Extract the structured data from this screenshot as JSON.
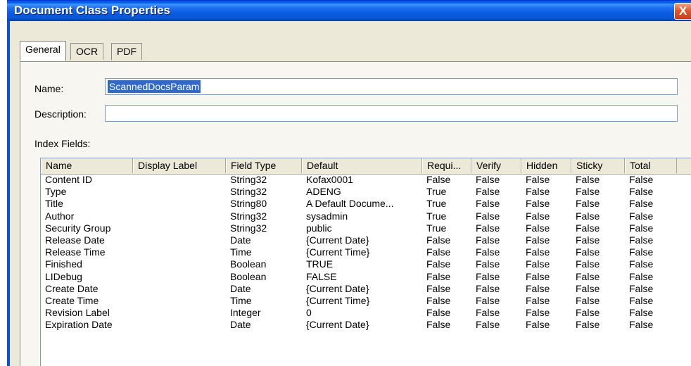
{
  "window": {
    "title": "Document Class Properties",
    "close_glyph": "X"
  },
  "tabs": [
    {
      "label": "General"
    },
    {
      "label": "OCR"
    },
    {
      "label": "PDF"
    }
  ],
  "form": {
    "name_label": "Name:",
    "name_value": "ScannedDocsParam",
    "description_label": "Description:",
    "description_value": "",
    "index_fields_label": "Index Fields:"
  },
  "table": {
    "headers": [
      "Name",
      "Display Label",
      "Field Type",
      "Default",
      "Requi...",
      "Verify",
      "Hidden",
      "Sticky",
      "Total"
    ],
    "rows": [
      [
        "Content ID",
        "",
        "String32",
        "Kofax0001",
        "False",
        "False",
        "False",
        "False",
        "False"
      ],
      [
        "Type",
        "",
        "String32",
        "ADENG",
        "True",
        "False",
        "False",
        "False",
        "False"
      ],
      [
        "Title",
        "",
        "String80",
        "A Default Docume...",
        "True",
        "False",
        "False",
        "False",
        "False"
      ],
      [
        "Author",
        "",
        "String32",
        "sysadmin",
        "True",
        "False",
        "False",
        "False",
        "False"
      ],
      [
        "Security Group",
        "",
        "String32",
        "public",
        "True",
        "False",
        "False",
        "False",
        "False"
      ],
      [
        "Release Date",
        "",
        "Date",
        "{Current Date}",
        "False",
        "False",
        "False",
        "False",
        "False"
      ],
      [
        "Release Time",
        "",
        "Time",
        "{Current Time}",
        "False",
        "False",
        "False",
        "False",
        "False"
      ],
      [
        "Finished",
        "",
        "Boolean",
        "TRUE",
        "False",
        "False",
        "False",
        "False",
        "False"
      ],
      [
        "LIDebug",
        "",
        "Boolean",
        "FALSE",
        "False",
        "False",
        "False",
        "False",
        "False"
      ],
      [
        "Create Date",
        "",
        "Date",
        "{Current Date}",
        "False",
        "False",
        "False",
        "False",
        "False"
      ],
      [
        "Create Time",
        "",
        "Time",
        "{Current Time}",
        "False",
        "False",
        "False",
        "False",
        "False"
      ],
      [
        "Revision Label",
        "",
        "Integer",
        "0",
        "False",
        "False",
        "False",
        "False",
        "False"
      ],
      [
        "Expiration Date",
        "",
        "Date",
        "{Current Date}",
        "False",
        "False",
        "False",
        "False",
        "False"
      ]
    ]
  }
}
